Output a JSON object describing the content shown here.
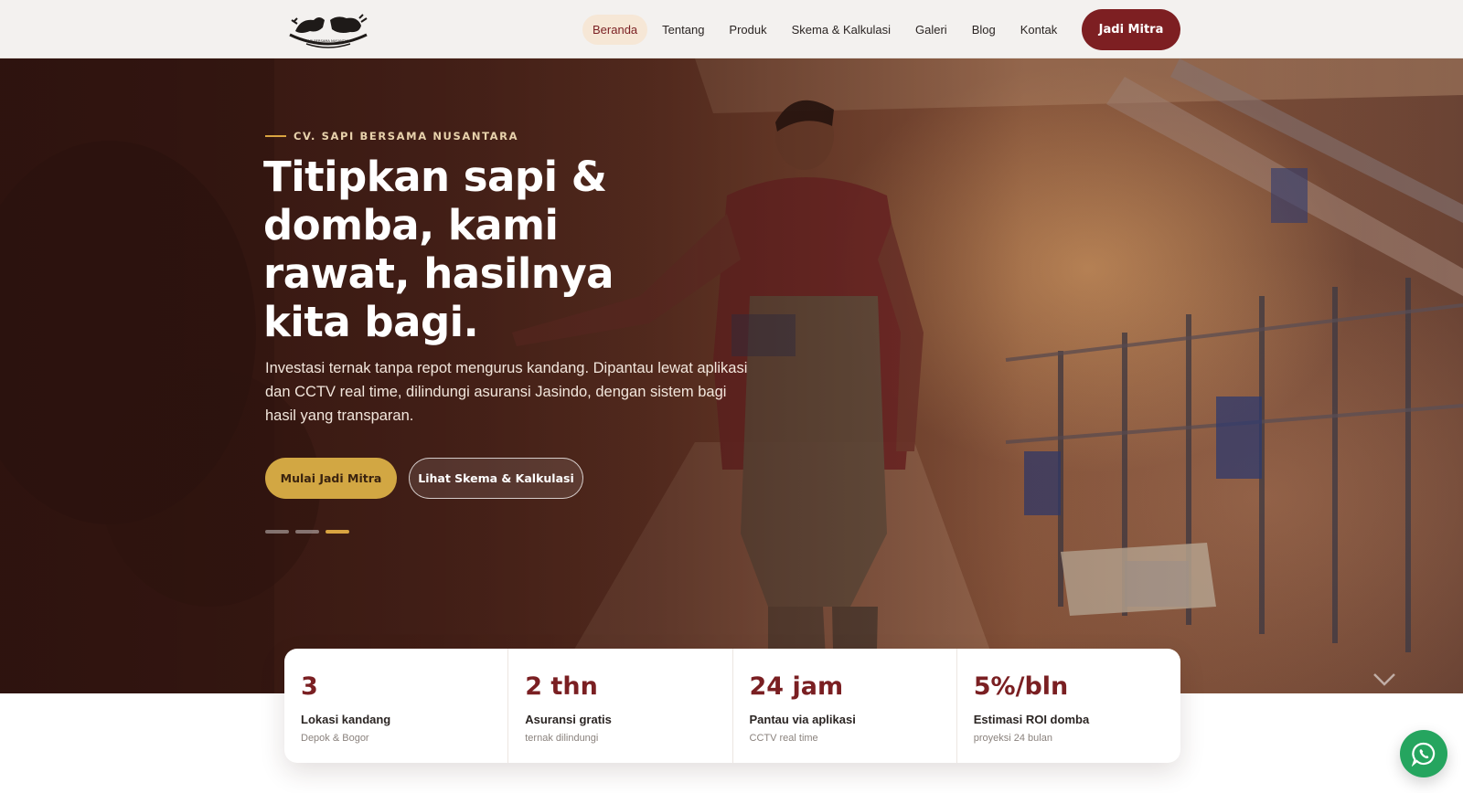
{
  "brand": {
    "logo_icon": "cow-and-sheep-logo-icon",
    "logo_text": "SAPI BERSAMA NUSANTARA"
  },
  "nav": {
    "items": [
      {
        "label": "Beranda",
        "active": true
      },
      {
        "label": "Tentang",
        "active": false
      },
      {
        "label": "Produk",
        "active": false
      },
      {
        "label": "Skema & Kalkulasi",
        "active": false
      },
      {
        "label": "Galeri",
        "active": false
      },
      {
        "label": "Blog",
        "active": false
      },
      {
        "label": "Kontak",
        "active": false
      }
    ],
    "cta_label": "Jadi Mitra"
  },
  "hero": {
    "eyebrow": "CV. SAPI BERSAMA NUSANTARA",
    "title": "Titipkan sapi & domba, kami rawat, hasilnya kita bagi.",
    "description": "Investasi ternak tanpa repot mengurus kandang. Dipantau lewat aplikasi dan CCTV real time, dilindungi asuransi Jasindo, dengan sistem bagi hasil yang transparan.",
    "primary_cta": "Mulai Jadi Mitra",
    "secondary_cta": "Lihat Skema & Kalkulasi",
    "slides_total": 3,
    "active_slide": 3
  },
  "stats": [
    {
      "value": "3",
      "label": "Lokasi kandang",
      "sub": "Depok & Bogor"
    },
    {
      "value": "2 thn",
      "label": "Asuransi gratis",
      "sub": "ternak dilindungi"
    },
    {
      "value": "24 jam",
      "label": "Pantau via aplikasi",
      "sub": "CCTV real time"
    },
    {
      "value": "5%/bln",
      "label": "Estimasi ROI domba",
      "sub": "proyeksi 24 bulan"
    }
  ],
  "floating": {
    "whatsapp_icon": "whatsapp-icon"
  },
  "colors": {
    "primary_maroon": "#7d1f22",
    "accent_gold": "#d2a743",
    "whatsapp_green": "#25a55f",
    "active_nav_bg": "#f6e7d6"
  }
}
